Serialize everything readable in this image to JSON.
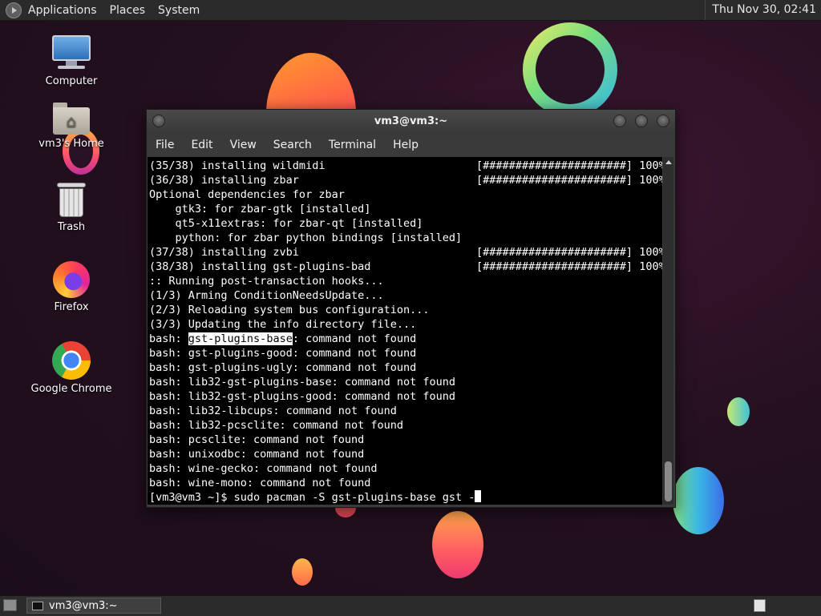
{
  "top_panel": {
    "menus": [
      "Applications",
      "Places",
      "System"
    ],
    "clock": "Thu Nov 30, 02:41"
  },
  "desktop": {
    "icons": [
      {
        "label": "Computer",
        "icon": "computer-icon"
      },
      {
        "label": "vm3's Home",
        "icon": "home-folder-icon"
      },
      {
        "label": "Trash",
        "icon": "trash-icon"
      },
      {
        "label": "Firefox",
        "icon": "firefox-icon"
      },
      {
        "label": "Google Chrome",
        "icon": "chrome-icon"
      }
    ]
  },
  "terminal": {
    "title": "vm3@vm3:~",
    "menu": [
      "File",
      "Edit",
      "View",
      "Search",
      "Terminal",
      "Help"
    ],
    "lines": [
      {
        "text": "(35/38) installing wildmidi",
        "progress": "[######################] 100%"
      },
      {
        "text": "(36/38) installing zbar",
        "progress": "[######################] 100%"
      },
      {
        "text": "Optional dependencies for zbar"
      },
      {
        "text": "    gtk3: for zbar-gtk [installed]"
      },
      {
        "text": "    qt5-x11extras: for zbar-qt [installed]"
      },
      {
        "text": "    python: for zbar python bindings [installed]"
      },
      {
        "text": "(37/38) installing zvbi",
        "progress": "[######################] 100%"
      },
      {
        "text": "(38/38) installing gst-plugins-bad",
        "progress": "[######################] 100%"
      },
      {
        "text": ":: Running post-transaction hooks..."
      },
      {
        "text": "(1/3) Arming ConditionNeedsUpdate..."
      },
      {
        "text": "(2/3) Reloading system bus configuration..."
      },
      {
        "text": "(3/3) Updating the info directory file..."
      },
      {
        "prefix": "bash: ",
        "highlight": "gst-plugins-base",
        "suffix": ": command not found"
      },
      {
        "text": "bash: gst-plugins-good: command not found"
      },
      {
        "text": "bash: gst-plugins-ugly: command not found"
      },
      {
        "text": "bash: lib32-gst-plugins-base: command not found"
      },
      {
        "text": "bash: lib32-gst-plugins-good: command not found"
      },
      {
        "text": "bash: lib32-libcups: command not found"
      },
      {
        "text": "bash: lib32-pcsclite: command not found"
      },
      {
        "text": "bash: pcsclite: command not found"
      },
      {
        "text": "bash: unixodbc: command not found"
      },
      {
        "text": "bash: wine-gecko: command not found"
      },
      {
        "text": "bash: wine-mono: command not found"
      }
    ],
    "prompt": "[vm3@vm3 ~]$ sudo pacman -S gst-plugins-base gst -"
  },
  "bottom_panel": {
    "task_label": "vm3@vm3:~"
  }
}
